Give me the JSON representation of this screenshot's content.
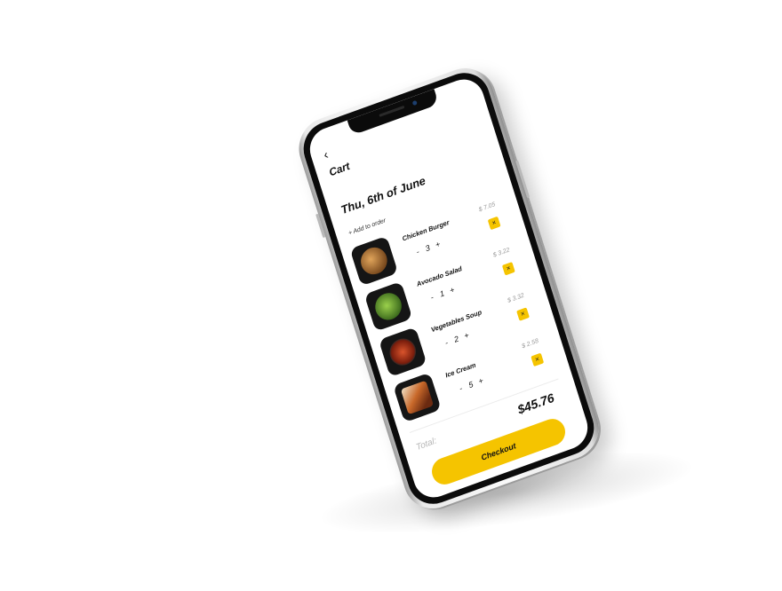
{
  "cart": {
    "title": "Cart",
    "date": "Thu, 6th of June",
    "add_to_order": "+ Add to order",
    "back_icon": "back-arrow-icon"
  },
  "items": [
    {
      "name": "Chicken Burger",
      "price": "$ 7.05",
      "qty": "3",
      "minus": "-",
      "plus": "+",
      "remove": "×",
      "icon": "burger-icon",
      "dish_color": "#b5773a"
    },
    {
      "name": "Avocado Salad",
      "price": "$ 3.22",
      "qty": "1",
      "minus": "-",
      "plus": "+",
      "remove": "×",
      "icon": "salad-icon",
      "dish_color": "#5b8a2e"
    },
    {
      "name": "Vegetables Soup",
      "price": "$ 3.32",
      "qty": "2",
      "minus": "-",
      "plus": "+",
      "remove": "×",
      "icon": "soup-icon",
      "dish_color": "#b3361d"
    },
    {
      "name": "Ice Cream",
      "price": "$ 2.58",
      "qty": "5",
      "minus": "-",
      "plus": "+",
      "remove": "×",
      "icon": "ice-cream-icon",
      "dish_color": "#c9692a"
    }
  ],
  "summary": {
    "total_label": "Total:",
    "total_value": "$45.76"
  },
  "checkout_label": "Checkout",
  "colors": {
    "accent": "#f5c400",
    "text": "#111111",
    "muted": "#9a9a9a"
  }
}
